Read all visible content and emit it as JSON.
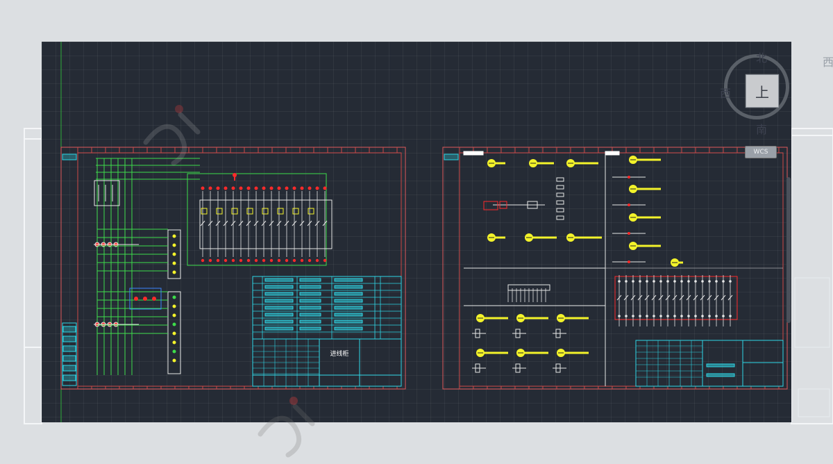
{
  "viewcube": {
    "north": "北",
    "west": "西",
    "south": "南",
    "east": "西",
    "face": "上",
    "wcs_label": "WCS"
  },
  "sheet_left": {
    "title_block_name": "进线柜"
  },
  "colors": {
    "model_space_background": "#252b35",
    "page_background": "#dcdfe2",
    "frame_outer": "#e05a5a",
    "frame_inner": "#d04848",
    "title_block": "#2fd7e6",
    "wiring": "#3ddc4a",
    "components": "#e8e8e8",
    "terminals": "#ff2a2a",
    "labels": "#f3f32a"
  },
  "icons": {
    "viewcube": "viewcube-icon",
    "compass": "compass-ring-icon",
    "watermark": "watermark-logo-icon"
  }
}
